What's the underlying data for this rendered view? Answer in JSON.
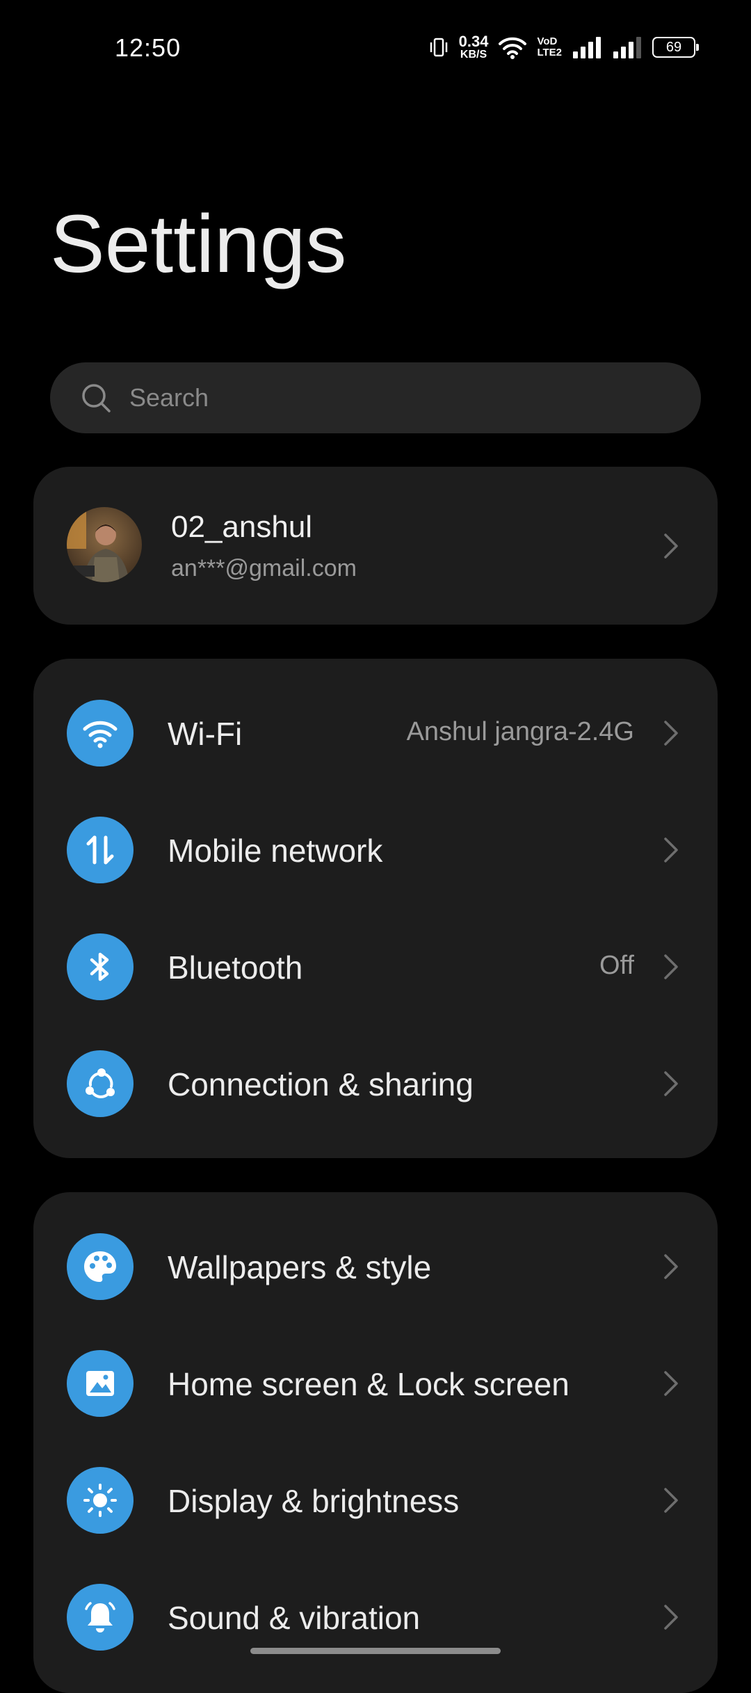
{
  "status_bar": {
    "time": "12:50",
    "net_speed_value": "0.34",
    "net_speed_unit": "KB/S",
    "volte_top": "VoD",
    "volte_bottom": "LTE2",
    "battery": "69"
  },
  "title": "Settings",
  "search": {
    "placeholder": "Search"
  },
  "account": {
    "name": "02_anshul",
    "email": "an***@gmail.com"
  },
  "connectivity": [
    {
      "label": "Wi-Fi",
      "value": "Anshul jangra-2.4G",
      "icon": "wifi-icon"
    },
    {
      "label": "Mobile network",
      "value": "",
      "icon": "mobile-data-icon"
    },
    {
      "label": "Bluetooth",
      "value": "Off",
      "icon": "bluetooth-icon"
    },
    {
      "label": "Connection & sharing",
      "value": "",
      "icon": "share-icon"
    }
  ],
  "personalization": [
    {
      "label": "Wallpapers & style",
      "icon": "palette-icon"
    },
    {
      "label": "Home screen & Lock screen",
      "icon": "image-icon"
    },
    {
      "label": "Display & brightness",
      "icon": "brightness-icon"
    },
    {
      "label": "Sound & vibration",
      "icon": "bell-icon"
    }
  ],
  "colors": {
    "accent": "#3a9be0",
    "card": "#1d1d1d",
    "background": "#000000"
  }
}
